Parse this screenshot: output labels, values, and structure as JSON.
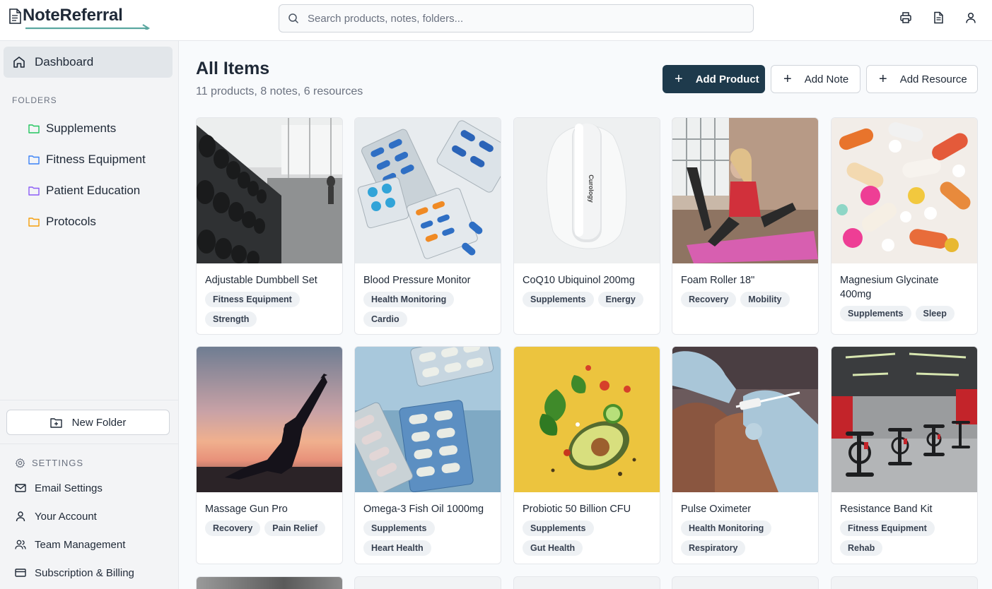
{
  "app": {
    "logo_text": "NoteReferral",
    "search_placeholder": "Search products, notes, folders...",
    "header_icons": [
      "printer-icon",
      "document-icon",
      "user-icon"
    ]
  },
  "sidebar": {
    "dashboard_label": "Dashboard",
    "folders_heading": "FOLDERS",
    "folders": [
      {
        "label": "Supplements",
        "color": "#22c55e"
      },
      {
        "label": "Fitness Equipment",
        "color": "#3b82f6"
      },
      {
        "label": "Patient Education",
        "color": "#8b5cf6"
      },
      {
        "label": "Protocols",
        "color": "#f59e0b"
      }
    ],
    "new_folder_label": "New Folder",
    "settings_heading": "SETTINGS",
    "settings_items": [
      {
        "label": "Email Settings",
        "icon": "mail-icon"
      },
      {
        "label": "Your Account",
        "icon": "user-icon"
      },
      {
        "label": "Team Management",
        "icon": "users-icon"
      },
      {
        "label": "Subscription & Billing",
        "icon": "credit-card-icon"
      }
    ]
  },
  "main": {
    "title": "All Items",
    "subtitle": "11 products, 8 notes, 6 resources",
    "buttons": {
      "add_product": "Add Product",
      "add_note": "Add Note",
      "add_resource": "Add Resource"
    },
    "accent_color": "#1e3a4c",
    "items": [
      {
        "name": "Adjustable Dumbbell Set",
        "tags": [
          "Fitness Equipment",
          "Strength"
        ],
        "image": "gym-dumbbell-rack"
      },
      {
        "name": "Blood Pressure Monitor",
        "tags": [
          "Health Monitoring",
          "Cardio"
        ],
        "image": "pill-blister-packs"
      },
      {
        "name": "CoQ10 Ubiquinol 200mg",
        "tags": [
          "Supplements",
          "Energy"
        ],
        "image": "white-bottle",
        "image_label": "Curology"
      },
      {
        "name": "Foam Roller 18\"",
        "tags": [
          "Recovery",
          "Mobility"
        ],
        "image": "woman-exercising"
      },
      {
        "name": "Magnesium Glycinate 400mg",
        "tags": [
          "Supplements",
          "Sleep"
        ],
        "image": "colorful-pills"
      },
      {
        "name": "Massage Gun Pro",
        "tags": [
          "Recovery",
          "Pain Relief"
        ],
        "image": "yoga-silhouette-sunset"
      },
      {
        "name": "Omega-3 Fish Oil 1000mg",
        "tags": [
          "Supplements",
          "Heart Health"
        ],
        "image": "blister-packs-blue"
      },
      {
        "name": "Probiotic 50 Billion CFU",
        "tags": [
          "Supplements",
          "Gut Health"
        ],
        "image": "avocado-vegetables-yellow"
      },
      {
        "name": "Pulse Oximeter",
        "tags": [
          "Health Monitoring",
          "Respiratory"
        ],
        "image": "gloved-injection"
      },
      {
        "name": "Resistance Band Kit",
        "tags": [
          "Fitness Equipment",
          "Rehab"
        ],
        "image": "spin-bikes-gym"
      }
    ]
  }
}
